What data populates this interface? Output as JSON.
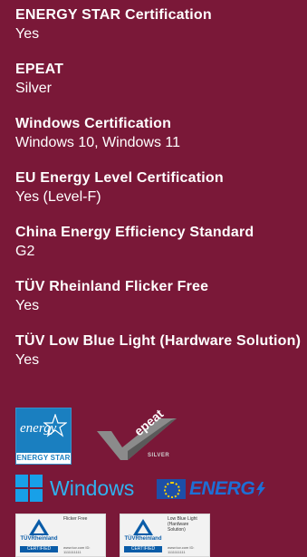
{
  "specs": [
    {
      "label": "ENERGY STAR Certification",
      "value": "Yes"
    },
    {
      "label": "EPEAT",
      "value": "Silver"
    },
    {
      "label": "Windows Certification",
      "value": "Windows 10, Windows 11"
    },
    {
      "label": "EU Energy Level Certification",
      "value": "Yes (Level-F)"
    },
    {
      "label": "China Energy Efficiency Standard",
      "value": "G2"
    },
    {
      "label": "TÜV Rheinland Flicker Free",
      "value": "Yes"
    },
    {
      "label": "TÜV Low Blue Light (Hardware Solution)",
      "value": "Yes"
    }
  ],
  "logos": {
    "energy_star": {
      "script": "energy",
      "label": "ENERGY STAR",
      "icon": "energy-star-logo"
    },
    "epeat": {
      "word": "epeat",
      "tier": "SILVER",
      "icon": "epeat-silver-logo"
    },
    "windows": {
      "word": "Windows",
      "icon": "windows-logo"
    },
    "energy_label": {
      "word": "ENERG",
      "icon": "eu-energy-label-logo"
    },
    "tuv_flicker": {
      "name": "TÜVRheinland",
      "cert": "CERTIFIED",
      "text": "Flicker Free",
      "id": "www.tuv.com ID: 1111111111",
      "icon": "tuv-flicker-free-logo"
    },
    "tuv_lowblue": {
      "name": "TÜVRheinland",
      "cert": "CERTIFIED",
      "text": "Low Blue Light (Hardware Solution)",
      "id": "www.tuv.com ID: 1111111111",
      "icon": "tuv-low-blue-light-logo"
    }
  },
  "colors": {
    "background": "#7a1838",
    "text": "#ffffff",
    "energy_star_blue": "#1a7fc0",
    "windows_blue": "#2fb2f0",
    "tuv_blue": "#0a5ca8"
  }
}
